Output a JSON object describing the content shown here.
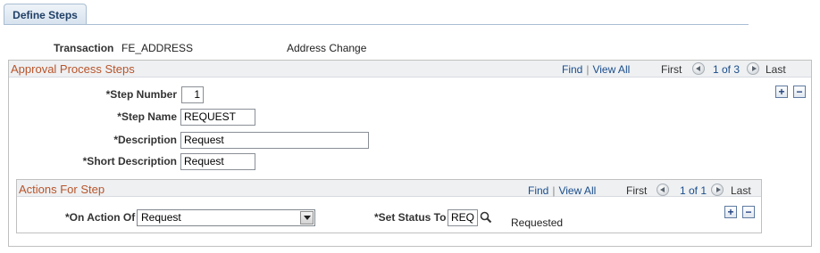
{
  "tab": {
    "label": "Define Steps"
  },
  "transaction": {
    "label": "Transaction",
    "code": "FE_ADDRESS",
    "description": "Address Change"
  },
  "approval": {
    "title": "Approval Process Steps",
    "nav": {
      "find": "Find",
      "view_all": "View All",
      "first": "First",
      "counter": "1 of 3",
      "last": "Last"
    },
    "step_number": {
      "label": "*Step Number",
      "value": "1"
    },
    "step_name": {
      "label": "*Step Name",
      "value": "REQUEST"
    },
    "description": {
      "label": "*Description",
      "value": "Request"
    },
    "short_description": {
      "label": "*Short Description",
      "value": "Request"
    },
    "add_label": "+",
    "remove_label": "−"
  },
  "actions": {
    "title": "Actions For Step",
    "nav": {
      "find": "Find",
      "view_all": "View All",
      "first": "First",
      "counter": "1 of 1",
      "last": "Last"
    },
    "on_action": {
      "label": "*On Action Of",
      "value": "Request"
    },
    "set_status": {
      "label": "*Set Status To",
      "value": "REQ",
      "description": "Requested"
    },
    "add_label": "+",
    "remove_label": "−"
  }
}
